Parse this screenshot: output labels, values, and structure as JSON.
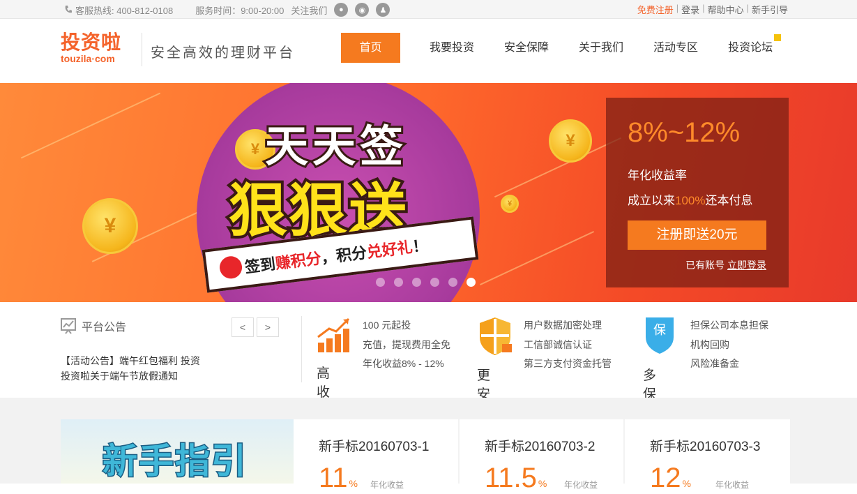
{
  "topbar": {
    "hotline": "客服热线: 400-812-0108",
    "hours": "服务时间：9:00-20:00",
    "follow": "关注我们",
    "links": {
      "register": "免费注册",
      "login": "登录",
      "help": "帮助中心",
      "guide": "新手引导"
    },
    "separator": "|"
  },
  "header": {
    "logo_cn": "投资啦",
    "logo_en": "touzila·com",
    "slogan": "安全高效的理财平台",
    "nav": [
      "首页",
      "我要投资",
      "安全保障",
      "关于我们",
      "活动专区",
      "投资论坛"
    ]
  },
  "banner": {
    "title1": "天天签",
    "title2": "狠狠送",
    "ribbon_a": "签到",
    "ribbon_b": "赚积分",
    "ribbon_c": "，积分",
    "ribbon_d": "兑好礼",
    "ribbon_e": "！",
    "coin_symbol": "¥",
    "promo": {
      "rate": "8%~12%",
      "rate_label": "年化收益率",
      "since_a": "成立以来",
      "since_b": "100%",
      "since_c": "还本付息",
      "cta": "注册即送20元",
      "has_account": "已有账号",
      "login_now": "立即登录"
    }
  },
  "notice": {
    "title": "平台公告",
    "prev": "<",
    "next": ">",
    "items": [
      "【活动公告】端午红包福利 投资",
      "投资啦关于端午节放假通知"
    ]
  },
  "features": [
    {
      "big": "高收益",
      "lines": [
        "100 元起投",
        "充值，提现费用全免",
        "年化收益8% - 12%"
      ]
    },
    {
      "big": "更安全",
      "lines": [
        "用户数据加密处理",
        "工信部诚信认证",
        "第三方支付资金托管"
      ]
    },
    {
      "big": "多保障",
      "icon_text": "保",
      "lines": [
        "担保公司本息担保",
        "机构回购",
        "风险准备金"
      ]
    }
  ],
  "guide": {
    "title": "新手指引"
  },
  "products": [
    {
      "name": "新手标20160703-1",
      "rate": "11",
      "unit": "%",
      "label": "年化收益"
    },
    {
      "name": "新手标20160703-2",
      "rate": "11.5",
      "unit": "%",
      "label": "年化收益"
    },
    {
      "name": "新手标20160703-3",
      "rate": "12",
      "unit": "%",
      "label": "年化收益"
    }
  ]
}
